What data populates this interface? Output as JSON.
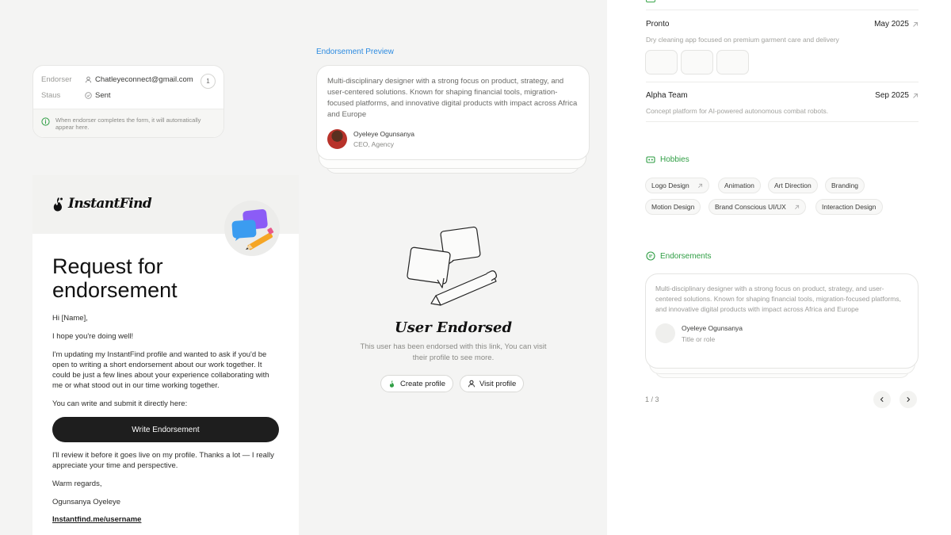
{
  "status_card": {
    "endorser_label": "Endorser",
    "endorser_value": "Chatleyeconnect@gmail.com",
    "status_label": "Staus",
    "status_value": "Sent",
    "count": "1",
    "info_text": "When endorser completes the form, it will automatically appear here."
  },
  "email": {
    "logo_text": "InstantFind",
    "title": "Request for endorsement",
    "greeting": "Hi [Name],",
    "p1": "I hope you're doing well!",
    "p2": "I'm updating my InstantFind profile and wanted to ask if you'd be open to writing a short endorsement about our work together. It could be just a few lines about your experience collaborating with me or what stood out in our time working together.",
    "p3": "You can write and submit it directly here:",
    "button_label": "Write Endorsement",
    "p4": "I'll review it before it goes live on my profile. Thanks a lot — I really appreciate your time and perspective.",
    "signoff": "Warm regards,",
    "sender": "Ogunsanya Oyeleye",
    "link": "Instantfind.me/username"
  },
  "preview": {
    "label": "Endorsement Preview",
    "quote": "Multi-disciplinary designer with a strong focus on product, strategy, and user-centered solutions. Known for shaping financial tools, migration-focused platforms, and innovative digital products with impact across Africa and Europe",
    "name": "Oyeleye Ogunsanya",
    "role": "CEO, Agency"
  },
  "endorsed": {
    "title": "User Endorsed",
    "subtitle": "This user has been endorsed with this link, You can visit their profile to see more.",
    "create_label": "Create profile",
    "visit_label": "Visit profile"
  },
  "projects": [
    {
      "name": "Pronto",
      "date": "May 2025",
      "desc": "Dry cleaning app focused on premium garment care and delivery"
    },
    {
      "name": "Alpha Team",
      "date": "Sep 2025",
      "desc": "Concept platform for AI-powered autonomous combat robots."
    }
  ],
  "hobbies": {
    "title": "Hobbies",
    "chips": [
      "Logo Design",
      "Animation",
      "Art Direction",
      "Branding",
      "Motion Design",
      "Brand Conscious UI/UX",
      "Interaction Design"
    ]
  },
  "endorsements": {
    "title": "Endorsements",
    "quote": "Multi-disciplinary designer with a strong focus on product, strategy, and user-centered solutions. Known for shaping financial tools, migration-focused platforms, and innovative digital products with impact across Africa and Europe",
    "name": "Oyeleye Ogunsanya",
    "role": "Title or role",
    "pager": "1 / 3"
  },
  "colors": {
    "accent_green": "#2f9e44",
    "link_blue": "#2b8ae0",
    "dark_button": "#1e1e1e"
  },
  "icons": [
    "user-icon",
    "check-circle-icon",
    "info-icon",
    "brand-logo-icon",
    "external-link-icon",
    "chevron-left-icon",
    "chevron-right-icon",
    "hobbies-icon",
    "endorsements-icon"
  ]
}
